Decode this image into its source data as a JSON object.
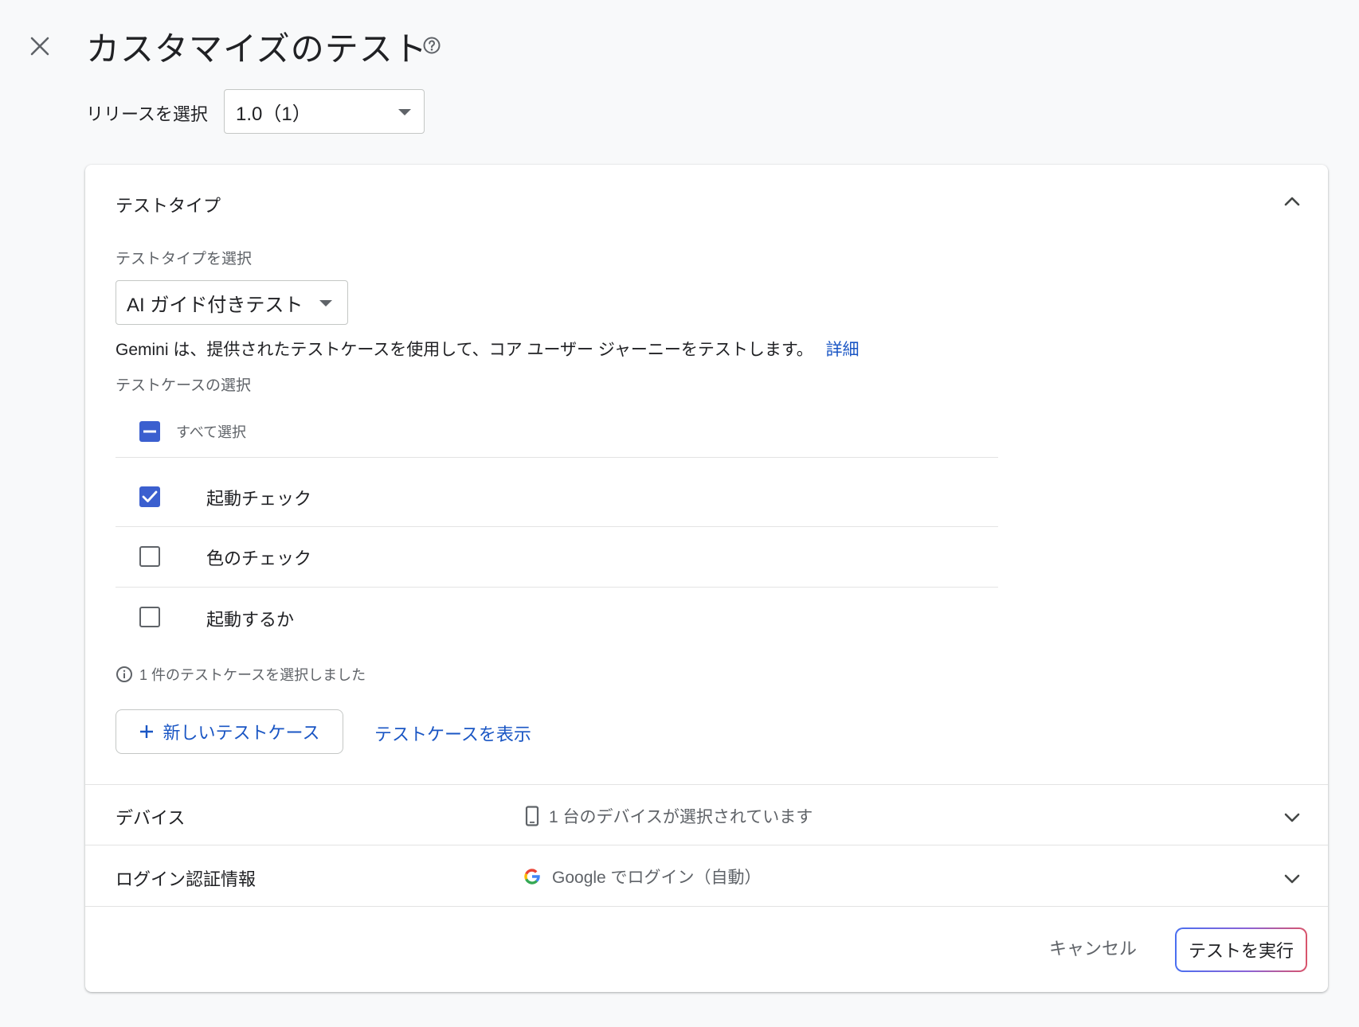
{
  "header": {
    "title": "カスタマイズのテスト",
    "close_icon": "close-icon",
    "help_icon": "help-circle-icon"
  },
  "release": {
    "label": "リリースを選択",
    "selected": "1.0（1）"
  },
  "test_type_section": {
    "title": "テストタイプ",
    "select_label": "テストタイプを選択",
    "selected_type": "AI ガイド付きテスト",
    "description": "Gemini は、提供されたテストケースを使用して、コア ユーザー ジャーニーをテストします。",
    "details_link": "詳細",
    "test_case_label": "テストケースの選択",
    "select_all_label": "すべて選択",
    "test_cases": [
      {
        "label": "起動チェック",
        "checked": true
      },
      {
        "label": "色のチェック",
        "checked": false
      },
      {
        "label": "起動するか",
        "checked": false
      }
    ],
    "selection_info": "1 件のテストケースを選択しました",
    "new_case_button": "新しいテストケース",
    "view_cases_link": "テストケースを表示"
  },
  "devices_section": {
    "title": "デバイス",
    "summary": "1 台のデバイスが選択されています",
    "icon": "phone-icon"
  },
  "login_section": {
    "title": "ログイン認証情報",
    "summary": "Google でログイン（自動）",
    "icon": "google-icon"
  },
  "footer": {
    "cancel_label": "キャンセル",
    "run_label": "テストを実行"
  },
  "colors": {
    "accent": "#3b5fcf",
    "link": "#1a56c4",
    "background": "#f8f9fa"
  }
}
